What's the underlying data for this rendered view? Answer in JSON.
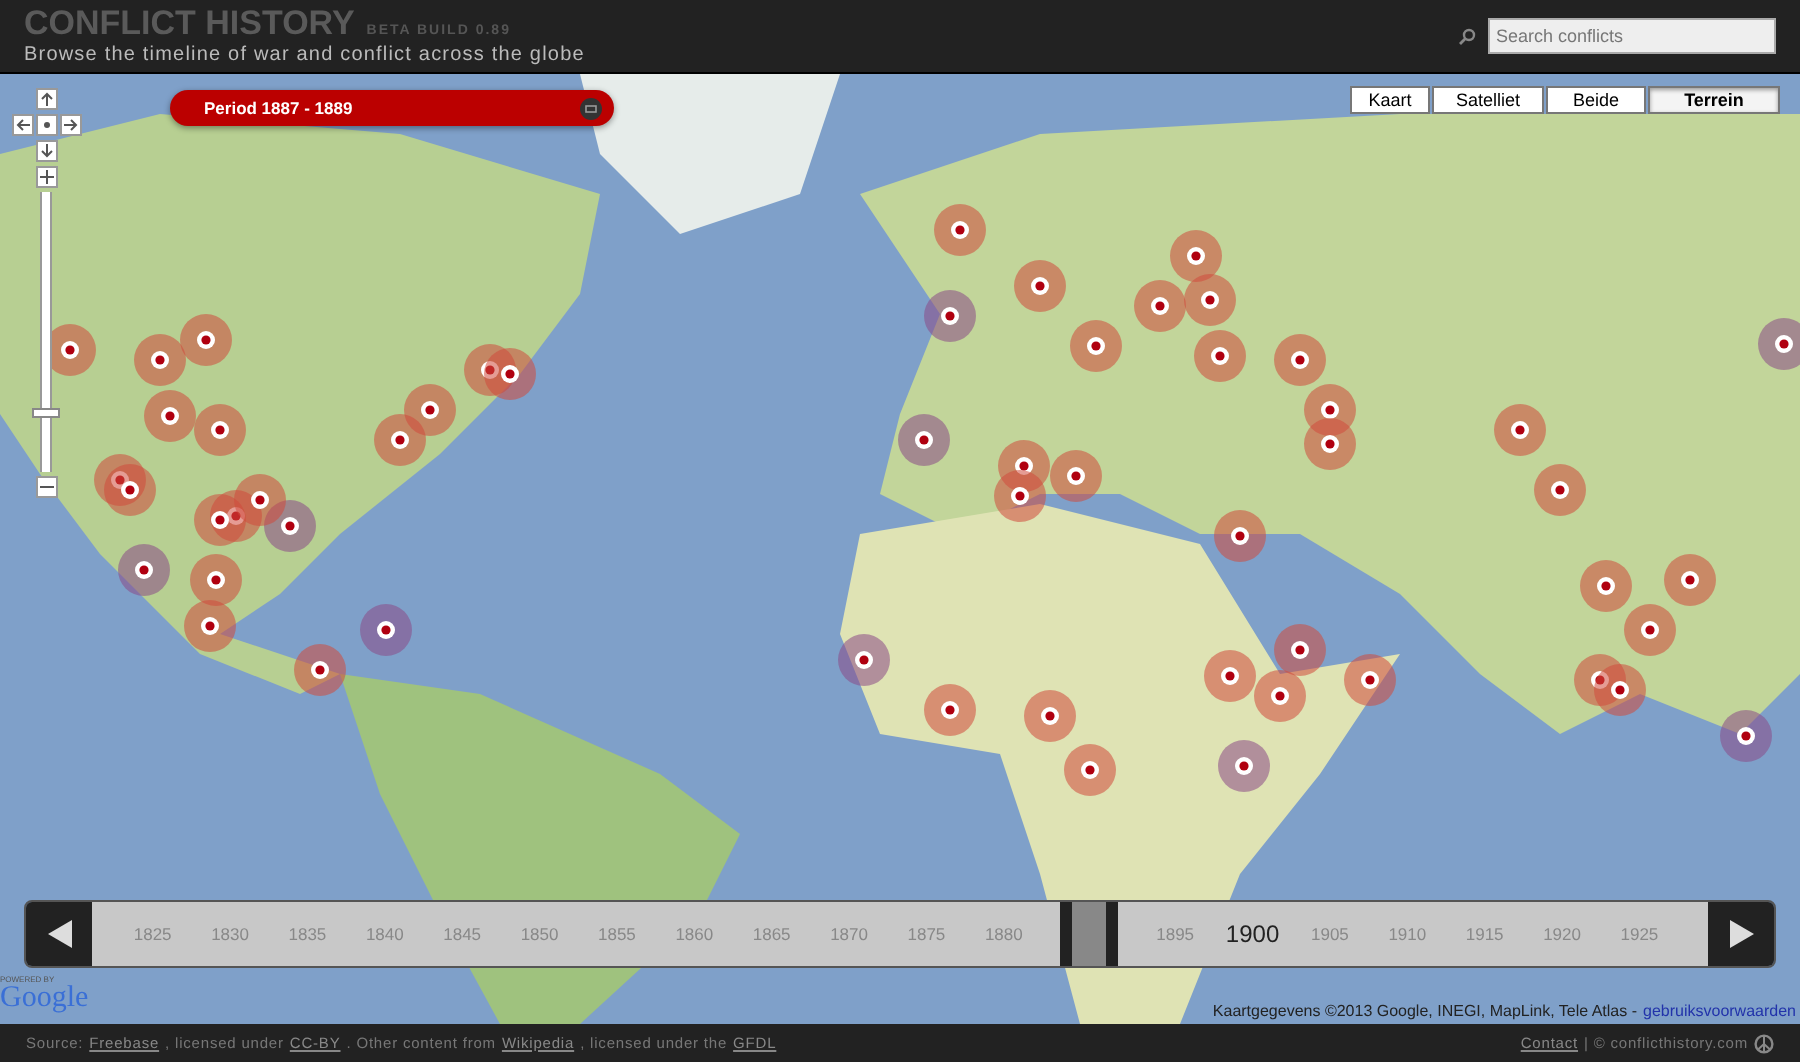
{
  "header": {
    "title": "CONFLICT HISTORY",
    "build": "BETA BUILD 0.89",
    "subtitle": "Browse the timeline of war and conflict across the globe"
  },
  "search": {
    "placeholder": "Search conflicts"
  },
  "period": {
    "label": "Period 1887 - 1889"
  },
  "zoom_control": {
    "level": 0.2
  },
  "map_types": [
    {
      "label": "Kaart",
      "selected": false
    },
    {
      "label": "Satelliet",
      "selected": false
    },
    {
      "label": "Beide",
      "selected": false
    },
    {
      "label": "Terrein",
      "selected": true
    }
  ],
  "timeline": {
    "items": [
      {
        "kind": "year",
        "label": "1825",
        "selected": false
      },
      {
        "kind": "year",
        "label": "1830",
        "selected": false
      },
      {
        "kind": "year",
        "label": "1835",
        "selected": false
      },
      {
        "kind": "year",
        "label": "1840",
        "selected": false
      },
      {
        "kind": "year",
        "label": "1845",
        "selected": false
      },
      {
        "kind": "year",
        "label": "1850",
        "selected": false
      },
      {
        "kind": "year",
        "label": "1855",
        "selected": false
      },
      {
        "kind": "year",
        "label": "1860",
        "selected": false
      },
      {
        "kind": "year",
        "label": "1865",
        "selected": false
      },
      {
        "kind": "year",
        "label": "1870",
        "selected": false
      },
      {
        "kind": "year",
        "label": "1875",
        "selected": false
      },
      {
        "kind": "year",
        "label": "1880",
        "selected": false
      },
      {
        "kind": "handle"
      },
      {
        "kind": "year",
        "label": "1895",
        "selected": false
      },
      {
        "kind": "year",
        "label": "1900",
        "selected": true
      },
      {
        "kind": "year",
        "label": "1905",
        "selected": false
      },
      {
        "kind": "year",
        "label": "1910",
        "selected": false
      },
      {
        "kind": "year",
        "label": "1915",
        "selected": false
      },
      {
        "kind": "year",
        "label": "1920",
        "selected": false
      },
      {
        "kind": "year",
        "label": "1925",
        "selected": false
      }
    ]
  },
  "google": {
    "powered_by": "POWERED BY",
    "logo": "Google"
  },
  "map_attribution": {
    "text": "Kaartgegevens ©2013 Google, INEGI, MapLink, Tele Atlas -",
    "link": "gebruiksvoorwaarden"
  },
  "footer": {
    "source": [
      {
        "text": "Source:",
        "link": false
      },
      {
        "text": "Freebase",
        "link": true
      },
      {
        "text": ", licensed under",
        "link": false
      },
      {
        "text": "CC-BY",
        "link": true
      },
      {
        "text": ". Other content from",
        "link": false
      },
      {
        "text": "Wikipedia",
        "link": true
      },
      {
        "text": ", licensed under the",
        "link": false
      },
      {
        "text": "GFDL",
        "link": true
      }
    ],
    "contact": "Contact",
    "copyright": "| © conflicthistory.com"
  }
}
